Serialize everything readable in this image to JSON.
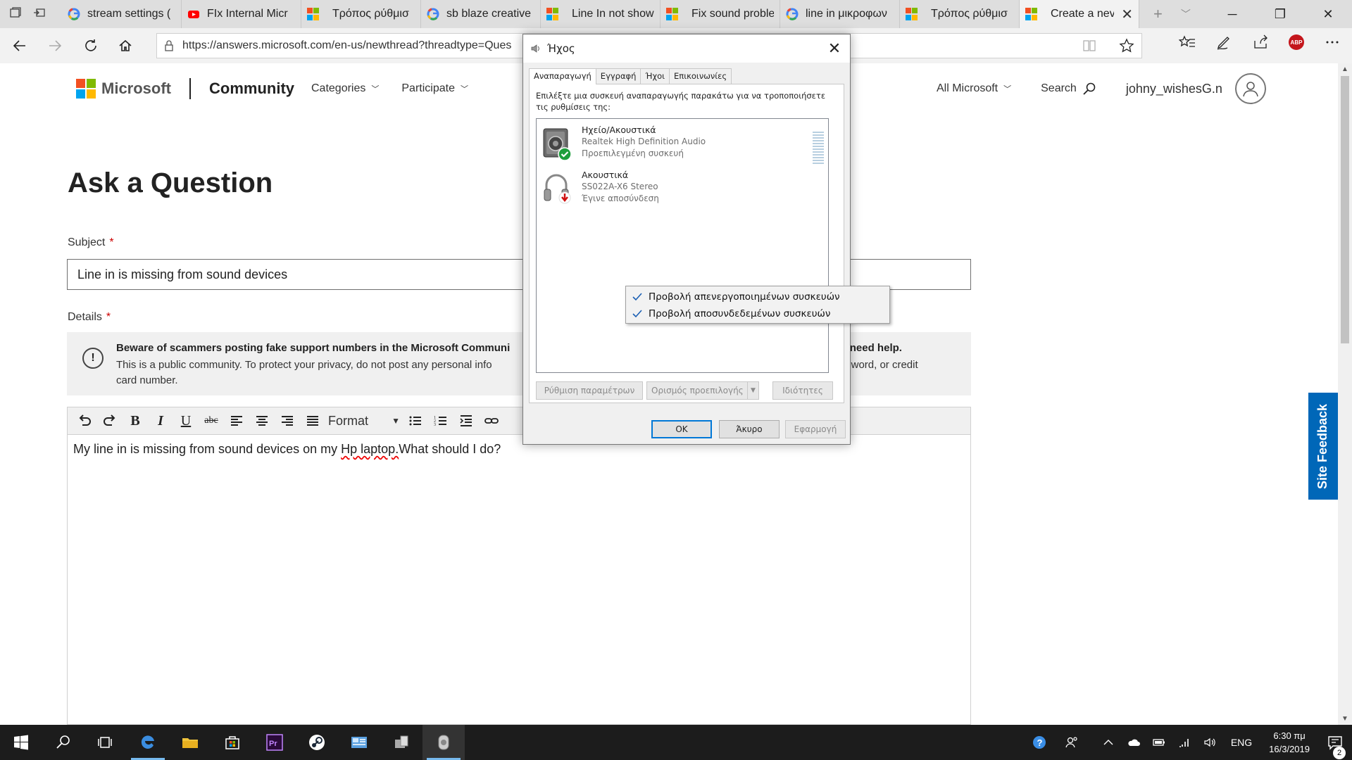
{
  "browser": {
    "tabs": [
      {
        "title": "stream settings (",
        "favicon": "google-icon"
      },
      {
        "title": "FIx Internal Micr",
        "favicon": "youtube-icon"
      },
      {
        "title": "Τρόπος ρύθμισ",
        "favicon": "microsoft-icon"
      },
      {
        "title": "sb blaze creative",
        "favicon": "google-icon"
      },
      {
        "title": "Line In not show",
        "favicon": "microsoft-icon"
      },
      {
        "title": "Fix sound proble",
        "favicon": "microsoft-icon"
      },
      {
        "title": "line in μικροφων",
        "favicon": "google-icon"
      },
      {
        "title": "Τρόπος ρύθμισ",
        "favicon": "microsoft-icon"
      },
      {
        "title": "Create a nev",
        "favicon": "microsoft-icon",
        "active": true
      }
    ],
    "new_tab": "+",
    "url": "https://answers.microsoft.com/en-us/newthread?threadtype=Ques",
    "abp_label": "ABP"
  },
  "site": {
    "brand": "Microsoft",
    "community": "Community",
    "nav": [
      "Categories",
      "Participate"
    ],
    "all_microsoft": "All Microsoft",
    "search": "Search",
    "username": "johny_wishesG.n",
    "brand_colors": [
      "#f25022",
      "#7fba00",
      "#00a4ef",
      "#ffb900"
    ]
  },
  "form": {
    "page_title": "Ask a Question",
    "subject_label": "Subject",
    "required_mark": "*",
    "subject_value": "Line in is missing from sound devices",
    "details_label": "Details",
    "warning_title": "Beware of scammers posting fake support numbers in the Microsoft Communi",
    "warning_title_tail": "ou need help.",
    "warning_text": "This is a public community. To protect your privacy, do not post any personal info",
    "warning_text_tail": ", password, or credit",
    "warning_text_2": "card number.",
    "format_label": "Format",
    "editor_text_1": "My line in is missing from sound devices on my ",
    "editor_text_sp": "Hp laptop.",
    "editor_text_2": "What should I do?"
  },
  "site_feedback": "Site Feedback",
  "sound_dialog": {
    "title": "Ήχος",
    "tabs": [
      "Αναπαραγωγή",
      "Εγγραφή",
      "Ήχοι",
      "Επικοινωνίες"
    ],
    "instruction": "Επιλέξτε μια συσκευή αναπαραγωγής παρακάτω για να τροποποιήσετε τις ρυθμίσεις της:",
    "devices": [
      {
        "name": "Ηχείο/Ακουστικά",
        "driver": "Realtek High Definition Audio",
        "status": "Προεπιλεγμένη συσκευή",
        "icon": "speaker-icon",
        "badge": "default-check-icon"
      },
      {
        "name": "Ακουστικά",
        "driver": "SS022A-X6 Stereo",
        "status": "Έγινε αποσύνδεση",
        "icon": "headphones-icon",
        "badge": "disconnected-arrow-icon"
      }
    ],
    "buttons": {
      "configure": "Ρύθμιση παραμέτρων",
      "set_default": "Ορισμός προεπιλογής",
      "properties": "Ιδιότητες",
      "ok": "OK",
      "cancel": "Άκυρο",
      "apply": "Εφαρμογή"
    }
  },
  "context_menu": {
    "items": [
      {
        "label": "Προβολή απενεργοποιημένων συσκευών",
        "checked": true
      },
      {
        "label": "Προβολή αποσυνδεδεμένων συσκευών",
        "checked": true
      }
    ]
  },
  "taskbar": {
    "language": "ENG",
    "time": "6:30 πμ",
    "date": "16/3/2019",
    "notification_count": "2"
  }
}
